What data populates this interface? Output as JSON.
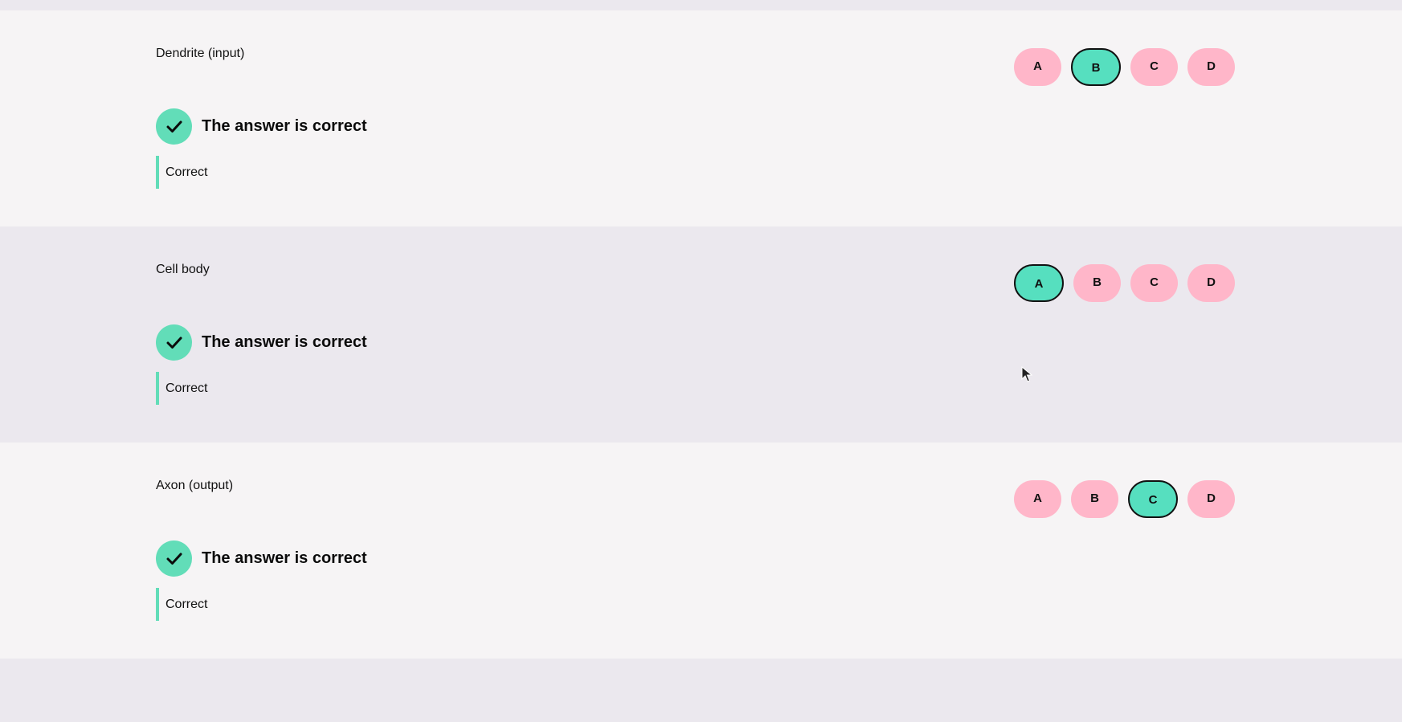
{
  "questions": [
    {
      "label": "Dendrite (input)",
      "selected": "B",
      "result": "The answer is correct",
      "feedback": "Correct",
      "options": [
        "A",
        "B",
        "C",
        "D"
      ]
    },
    {
      "label": "Cell body",
      "selected": "A",
      "result": "The answer is correct",
      "feedback": "Correct",
      "options": [
        "A",
        "B",
        "C",
        "D"
      ]
    },
    {
      "label": "Axon (output)",
      "selected": "C",
      "result": "The answer is correct",
      "feedback": "Correct",
      "options": [
        "A",
        "B",
        "C",
        "D"
      ]
    }
  ],
  "icons": {
    "check": "check-icon",
    "cursor": "mouse-pointer-icon"
  },
  "colors": {
    "correct": "#62ddb8",
    "option": "#ffb6c9",
    "selected": "#56dfbf"
  }
}
